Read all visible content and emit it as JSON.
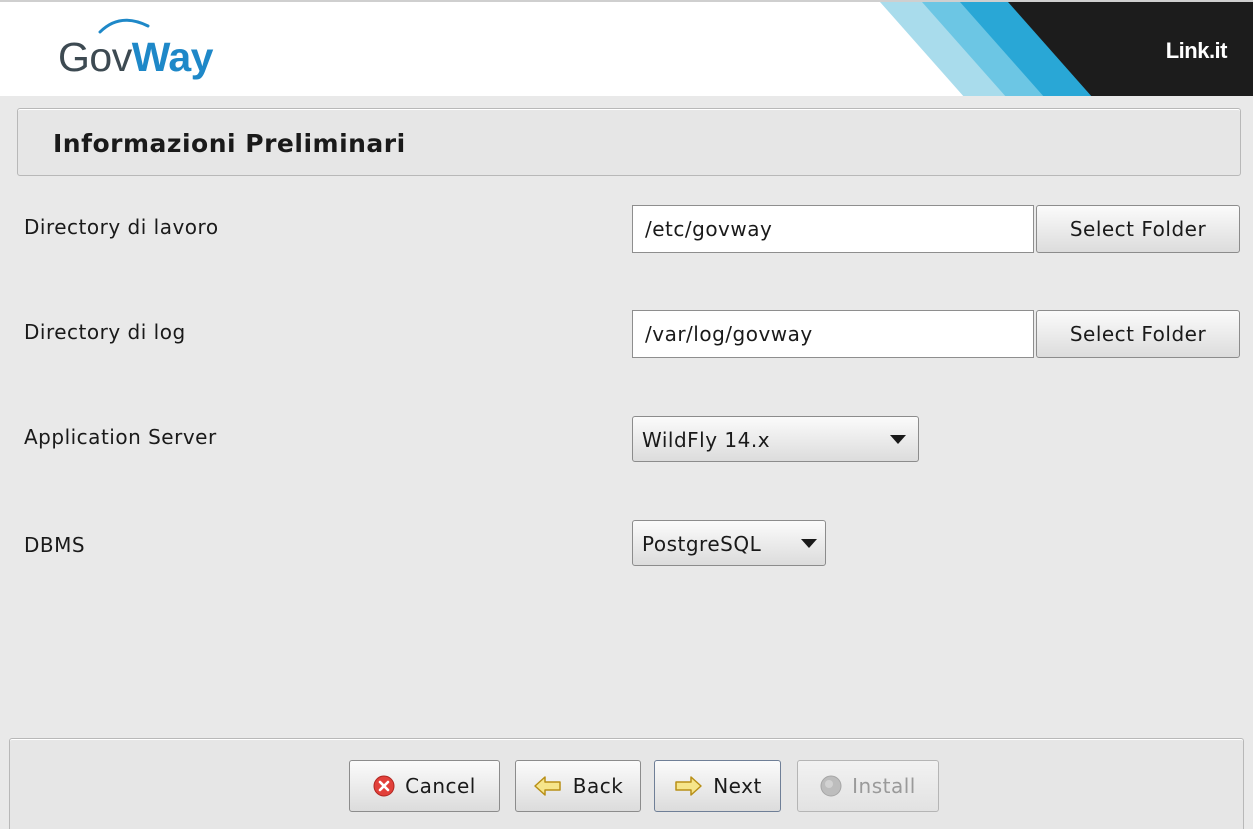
{
  "header": {
    "logo_text_1": "Gov",
    "logo_text_2": "Way",
    "brand": "Link.it",
    "colors": {
      "logo_gray": "#3d4a52",
      "logo_blue": "#1e88c8",
      "stripe_light": "#a9dcec",
      "stripe_cyan": "#29a7d6",
      "stripe_dark": "#1c1c1c"
    }
  },
  "page": {
    "title": "Informazioni Preliminari"
  },
  "form": {
    "work_dir": {
      "label": "Directory di lavoro",
      "value": "/etc/govway",
      "button": "Select Folder"
    },
    "log_dir": {
      "label": "Directory di log",
      "value": "/var/log/govway",
      "button": "Select Folder"
    },
    "app_server": {
      "label": "Application Server",
      "selected": "WildFly 14.x"
    },
    "dbms": {
      "label": "DBMS",
      "selected": "PostgreSQL"
    }
  },
  "footer": {
    "buttons": [
      {
        "label": "Cancel",
        "icon": "cancel-icon",
        "enabled": true
      },
      {
        "label": "Back",
        "icon": "arrow-left-icon",
        "enabled": true
      },
      {
        "label": "Next",
        "icon": "arrow-right-icon",
        "enabled": true
      },
      {
        "label": "Install",
        "icon": "install-icon",
        "enabled": false
      }
    ]
  }
}
